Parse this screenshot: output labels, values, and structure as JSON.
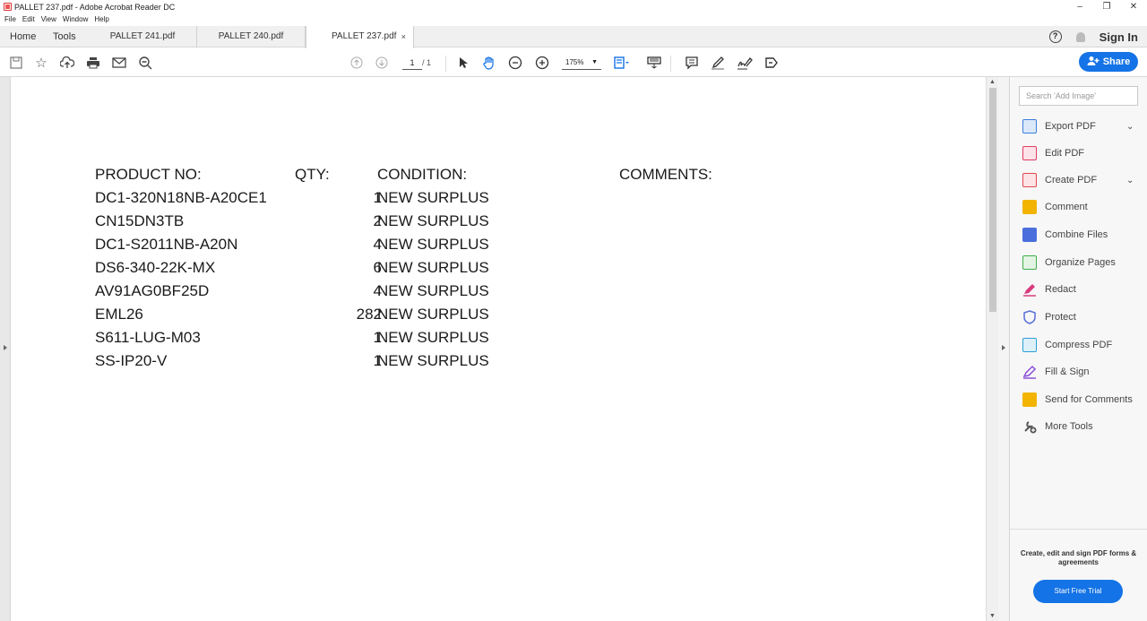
{
  "window": {
    "title": "PALLET 237.pdf - Adobe Acrobat Reader DC",
    "minimize": "–",
    "maximize": "❐",
    "close": "✕"
  },
  "menu": [
    "File",
    "Edit",
    "View",
    "Window",
    "Help"
  ],
  "tabs": {
    "home": "Home",
    "tools": "Tools",
    "docs": [
      "PALLET 241.pdf",
      "PALLET 240.pdf",
      "PALLET 237.pdf"
    ],
    "active_close": "×"
  },
  "header_right": {
    "help": "?",
    "signin": "Sign In"
  },
  "toolbar": {
    "page_current": "1",
    "page_total": "/ 1",
    "zoom": "175%",
    "share_label": "Share"
  },
  "document": {
    "headers": {
      "product": "PRODUCT NO:",
      "qty": "QTY:",
      "condition": "CONDITION:",
      "comments": "COMMENTS:"
    },
    "rows": [
      {
        "product": "DC1-320N18NB-A20CE1",
        "qty": "1",
        "condition": "NEW SURPLUS"
      },
      {
        "product": "CN15DN3TB",
        "qty": "2",
        "condition": "NEW SURPLUS"
      },
      {
        "product": "DC1-S2011NB-A20N",
        "qty": "4",
        "condition": "NEW SURPLUS"
      },
      {
        "product": "DS6-340-22K-MX",
        "qty": "6",
        "condition": "NEW SURPLUS"
      },
      {
        "product": "AV91AG0BF25D",
        "qty": "4",
        "condition": "NEW SURPLUS"
      },
      {
        "product": "EML26",
        "qty": "282",
        "condition": "NEW SURPLUS"
      },
      {
        "product": "S611-LUG-M03",
        "qty": "1",
        "condition": "NEW SURPLUS"
      },
      {
        "product": "SS-IP20-V",
        "qty": "1",
        "condition": "NEW SURPLUS"
      }
    ]
  },
  "tools_pane": {
    "search_placeholder": "Search 'Add Image'",
    "tools": [
      {
        "label": "Export PDF",
        "icon": "export-pdf-icon",
        "color": "#3b7dd8",
        "expand": true
      },
      {
        "label": "Edit PDF",
        "icon": "edit-pdf-icon",
        "color": "#e03c61",
        "expand": false
      },
      {
        "label": "Create PDF",
        "icon": "create-pdf-icon",
        "color": "#e34850",
        "expand": true
      },
      {
        "label": "Comment",
        "icon": "comment-icon",
        "color": "#f2b400",
        "expand": false
      },
      {
        "label": "Combine Files",
        "icon": "combine-files-icon",
        "color": "#4a6fdc",
        "expand": false
      },
      {
        "label": "Organize Pages",
        "icon": "organize-pages-icon",
        "color": "#3fae49",
        "expand": false
      },
      {
        "label": "Redact",
        "icon": "redact-icon",
        "color": "#d93a7e",
        "expand": false
      },
      {
        "label": "Protect",
        "icon": "protect-icon",
        "color": "#5a6fd8",
        "expand": false
      },
      {
        "label": "Compress PDF",
        "icon": "compress-pdf-icon",
        "color": "#2a9fd6",
        "expand": false
      },
      {
        "label": "Fill & Sign",
        "icon": "fill-sign-icon",
        "color": "#8a4fd8",
        "expand": false
      },
      {
        "label": "Send for Comments",
        "icon": "send-for-comments-icon",
        "color": "#f2b400",
        "expand": false
      },
      {
        "label": "More Tools",
        "icon": "more-tools-icon",
        "color": "#555555",
        "expand": false
      }
    ],
    "promo_text": "Create, edit and sign PDF forms & agreements",
    "promo_button": "Start Free Trial"
  },
  "colors": {
    "accent": "#1473e6"
  }
}
